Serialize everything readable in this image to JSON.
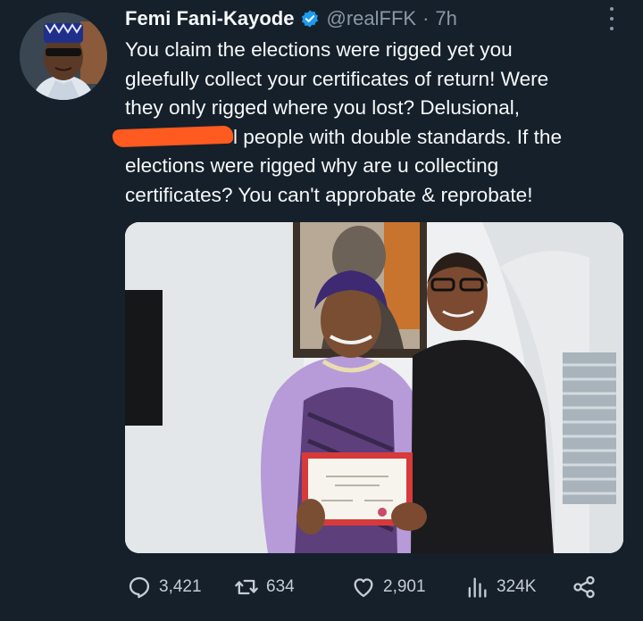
{
  "tweet": {
    "author": {
      "display_name": "Femi Fani-Kayode",
      "handle": "@realFFK",
      "separator": "·",
      "time": "7h"
    },
    "text_lines": {
      "l1": "You claim the elections were rigged yet you",
      "l2": "gleefully collect your certificates of return! Were",
      "l3": "they only rigged where you lost? Delusional,",
      "l4": "l people with double standards. If the",
      "l5": "elections were rigged why are u collecting",
      "l6": "certificates? You can't approbate & reprobate!"
    },
    "stats": {
      "replies": "3,421",
      "retweets": "634",
      "likes": "2,901",
      "views": "324K"
    }
  },
  "icons": {
    "verified": "verified-badge-icon",
    "more": "more-options-icon",
    "reply": "reply-icon",
    "retweet": "retweet-icon",
    "like": "heart-icon",
    "views": "views-chart-icon",
    "share": "share-icon"
  },
  "colors": {
    "background": "#15202b",
    "verified": "#1d9bf0",
    "redaction": "#ff5a1f",
    "muted_text": "#8b98a5"
  }
}
